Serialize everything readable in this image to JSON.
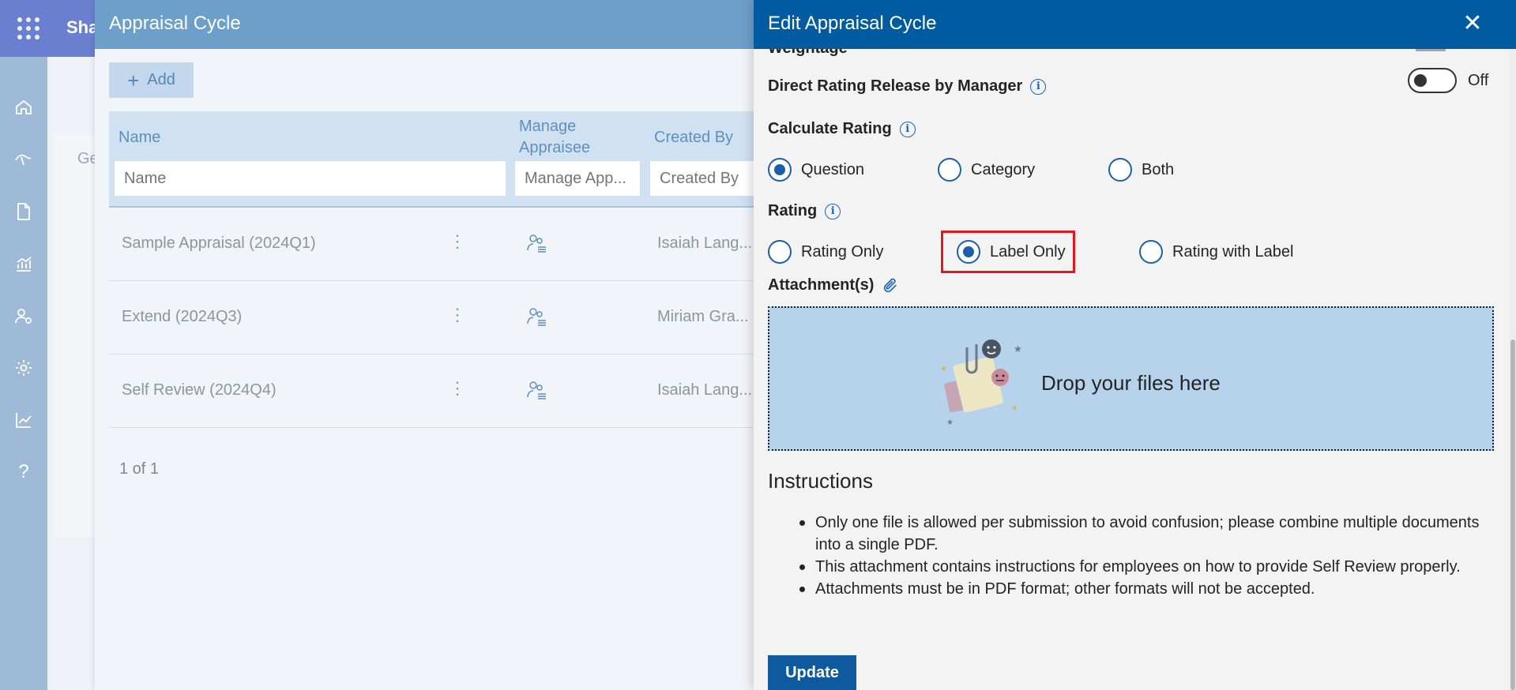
{
  "app": {
    "title_fragment": "Sha"
  },
  "background": {
    "card_title_fragment": "Ge"
  },
  "cycle_panel": {
    "title": "Appraisal Cycle",
    "add_label": "Add",
    "columns": {
      "name": "Name",
      "manage_line1": "Manage",
      "manage_line2": "Appraisee",
      "created_by": "Created By"
    },
    "filters": {
      "name_placeholder": "Name",
      "manage_placeholder": "Manage App...",
      "created_by_placeholder": "Created By"
    },
    "rows": [
      {
        "name": "Sample Appraisal (2024Q1)",
        "menu": "⋮",
        "created_by": "Isaiah Lang..."
      },
      {
        "name": "Extend (2024Q3)",
        "menu": "⋮",
        "created_by": "Miriam Gra..."
      },
      {
        "name": "Self Review (2024Q4)",
        "menu": "⋮",
        "created_by": "Isaiah Lang..."
      }
    ],
    "pager": "1 of 1"
  },
  "drawer": {
    "title": "Edit Appraisal Cycle",
    "close_glyph": "✕",
    "cut_label": "Weightage",
    "direct_release": {
      "label": "Direct Rating Release by Manager",
      "toggle_state": "Off"
    },
    "calculate_rating": {
      "label": "Calculate Rating",
      "options": [
        "Question",
        "Category",
        "Both"
      ],
      "selected": "Question"
    },
    "rating": {
      "label": "Rating",
      "options": [
        "Rating Only",
        "Label Only",
        "Rating with Label"
      ],
      "selected": "Label Only"
    },
    "attachments": {
      "label": "Attachment(s)",
      "drop_text": "Drop your files here"
    },
    "instructions": {
      "title": "Instructions",
      "items": [
        "Only one file is allowed per submission to avoid confusion; please combine multiple documents into a single PDF.",
        "This attachment contains instructions for employees on how to provide Self Review properly.",
        "Attachments must be in PDF format; other formats will not be accepted."
      ]
    },
    "update_label": "Update"
  },
  "colors": {
    "drawer_header": "#005ba1",
    "accent": "#1b5fa8",
    "highlight": "#e3171d",
    "dropzone": "#b7d3ec",
    "cycle_header": "#6c9fc9"
  },
  "icons": {
    "rail": [
      "home-icon",
      "performance-icon",
      "document-icon",
      "analytics-icon",
      "user-settings-icon",
      "gear-icon",
      "trend-icon",
      "help-icon"
    ]
  }
}
